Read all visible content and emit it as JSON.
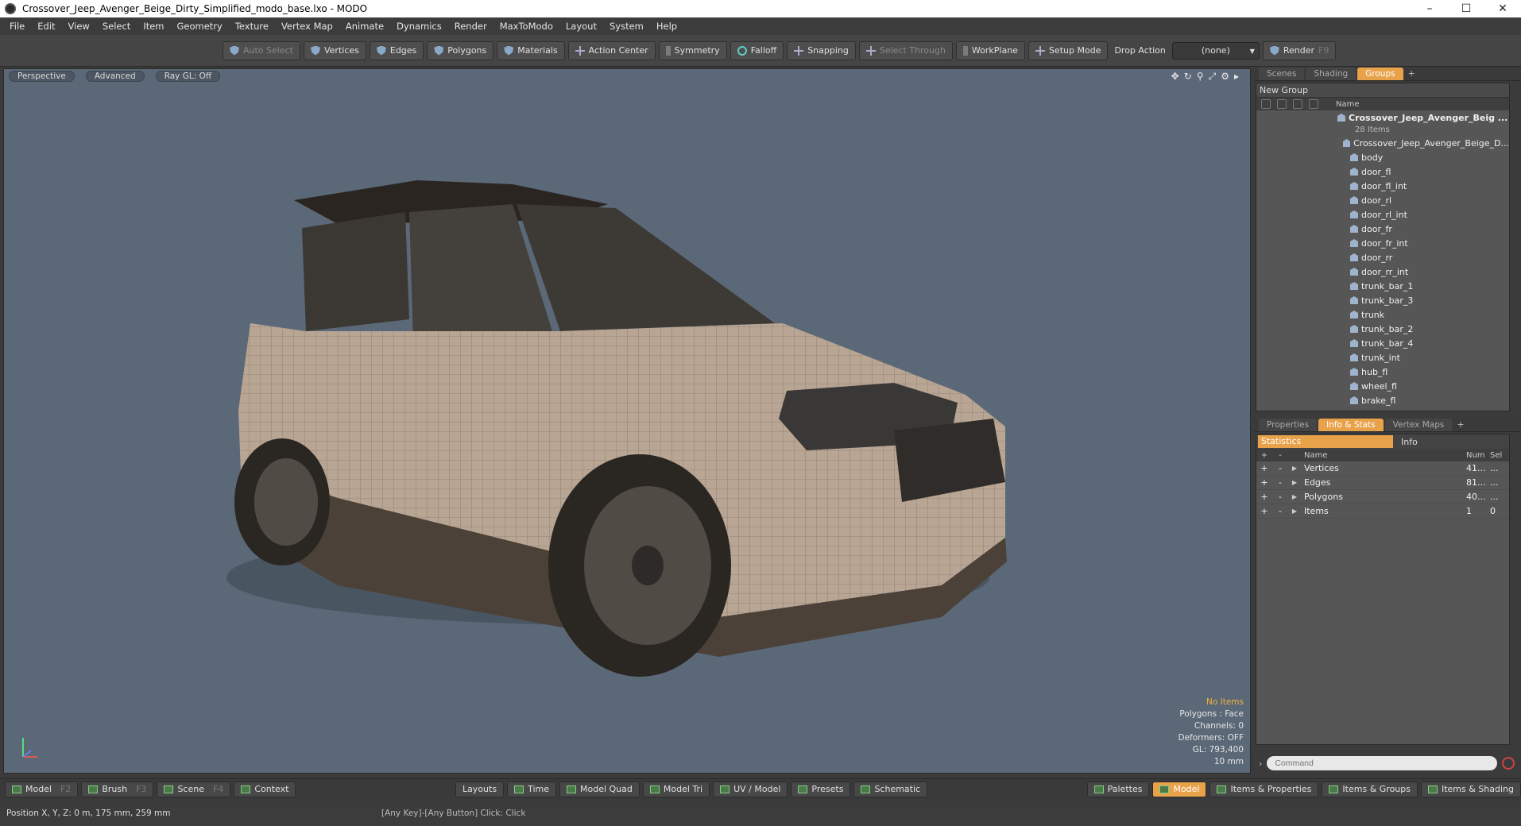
{
  "window": {
    "title": "Crossover_Jeep_Avenger_Beige_Dirty_Simplified_modo_base.lxo - MODO",
    "minimize": "–",
    "maximize": "☐",
    "close": "✕"
  },
  "menu": [
    "File",
    "Edit",
    "View",
    "Select",
    "Item",
    "Geometry",
    "Texture",
    "Vertex Map",
    "Animate",
    "Dynamics",
    "Render",
    "MaxToModo",
    "Layout",
    "System",
    "Help"
  ],
  "toolbar": {
    "auto_select": "Auto Select",
    "vertices": "Vertices",
    "edges": "Edges",
    "polygons": "Polygons",
    "materials": "Materials",
    "action_center": "Action Center",
    "symmetry": "Symmetry",
    "falloff": "Falloff",
    "snapping": "Snapping",
    "select_through": "Select Through",
    "workplane": "WorkPlane",
    "setup_mode": "Setup Mode",
    "drop_action_label": "Drop Action",
    "drop_action_value": "(none)",
    "render": "Render",
    "render_key": "F9"
  },
  "viewport": {
    "tabs": [
      "Perspective",
      "Advanced",
      "Ray GL: Off"
    ],
    "stats": {
      "items": "No Items",
      "polygons": "Polygons : Face",
      "channels": "Channels: 0",
      "deformers": "Deformers: OFF",
      "gl": "GL: 793,400",
      "scale": "10 mm"
    }
  },
  "groups_panel": {
    "tabs": [
      "Scenes",
      "Shading",
      "Groups"
    ],
    "active_tab": "Groups",
    "new_group": "New Group",
    "name_header": "Name",
    "root": "Crossover_Jeep_Avenger_Beig ...",
    "root_count": "28 Items",
    "items": [
      "Crossover_Jeep_Avenger_Beige_D...",
      "body",
      "door_fl",
      "door_fl_int",
      "door_rl",
      "door_rl_int",
      "door_fr",
      "door_fr_int",
      "door_rr",
      "door_rr_int",
      "trunk_bar_1",
      "trunk_bar_3",
      "trunk",
      "trunk_bar_2",
      "trunk_bar_4",
      "trunk_int",
      "hub_fl",
      "wheel_fl",
      "brake_fl"
    ]
  },
  "props_panel": {
    "tabs": [
      "Properties",
      "Info & Stats",
      "Vertex Maps"
    ],
    "active_tab": "Info & Stats",
    "statistics": "Statistics",
    "info": "Info",
    "headers": {
      "name": "Name",
      "num": "Num",
      "sel": "Sel"
    },
    "rows": [
      {
        "name": "Vertices",
        "num": "41...",
        "sel": "..."
      },
      {
        "name": "Edges",
        "num": "81...",
        "sel": "..."
      },
      {
        "name": "Polygons",
        "num": "40...",
        "sel": "..."
      },
      {
        "name": "Items",
        "num": "1",
        "sel": "0"
      }
    ]
  },
  "command": {
    "placeholder": "Command"
  },
  "bottombar": {
    "left": [
      {
        "label": "Model",
        "key": "F2"
      },
      {
        "label": "Brush",
        "key": "F3"
      },
      {
        "label": "Scene",
        "key": "F4"
      },
      {
        "label": "Context",
        "key": ""
      }
    ],
    "center": [
      "Layouts",
      "Time",
      "Model Quad",
      "Model Tri",
      "UV / Model",
      "Presets",
      "Schematic"
    ],
    "right": [
      "Palettes",
      "Model",
      "Items & Properties",
      "Items & Groups",
      "Items & Shading"
    ]
  },
  "status": {
    "position": "Position X, Y, Z:   0 m, 175 mm, 259 mm",
    "hint": "[Any Key]-[Any Button] Click:   Click"
  },
  "colors": {
    "accent": "#e8a24a",
    "viewport_bg": "#5b6877"
  }
}
